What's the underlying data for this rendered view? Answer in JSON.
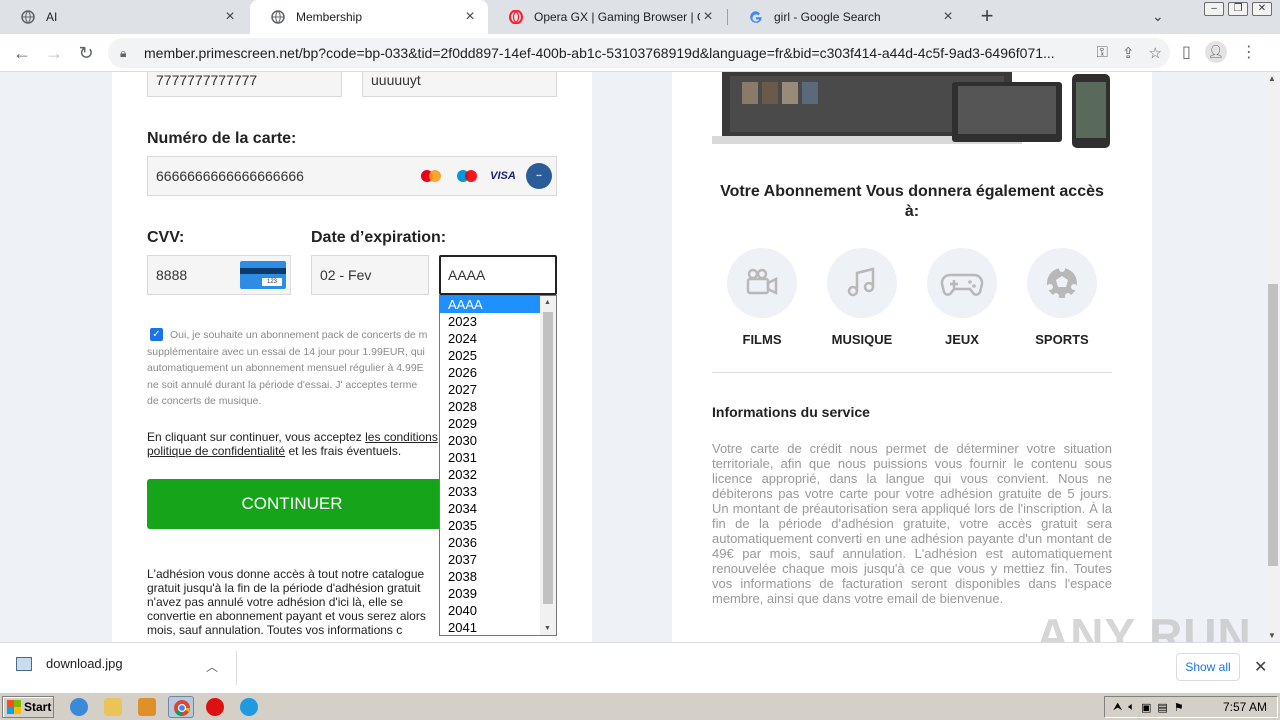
{
  "browser": {
    "tabs": [
      {
        "label": "AI",
        "active": false
      },
      {
        "label": "Membership",
        "active": true
      },
      {
        "label": "Opera GX | Gaming Browser | Opera",
        "active": false
      },
      {
        "label": "girl - Google Search",
        "active": false
      }
    ],
    "new_tab": "+",
    "url": "member.primescreen.net/bp?code=bp-033&tid=2f0dd897-14ef-400b-ab1c-53103768919d&language=fr&bid=c303f414-a44d-4c5f-9ad3-6496f071..."
  },
  "form": {
    "top_field_1": "7777777777777",
    "top_field_2": "uuuuuyt",
    "card_number_label": "Numéro de la carte:",
    "card_number_value": "6666666666666666666",
    "cvv_label": "CVV:",
    "cvv_value": "8888",
    "cvv_card_number": "123",
    "expiry_label": "Date d’expiration:",
    "expiry_month": "02 - Fev",
    "expiry_year": "AAAA",
    "checkbox_checked": true,
    "consent_line_1": "Oui, je souhaite un abonnement pack de concerts de m",
    "consent_line_2": "supplémentaire avec un essai de 14 jour pour 1.99EUR, qui",
    "consent_line_3": "automatiquement un abonnement mensuel régulier à 4.99E",
    "consent_line_4": "ne soit annulé durant la période d'essai. J' acceptes terme",
    "consent_line_5": "de concerts de musique.",
    "terms_prefix": "En cliquant sur continuer, vous acceptez ",
    "terms_link": "les conditions",
    "privacy_link": "politique de confidentialité",
    "terms_suffix": " et les frais éventuels.",
    "continue_label": "CONTINUER",
    "adhesion_line_1": "L'adhésion vous donne accès à tout notre catalogue",
    "adhesion_line_2": "gratuit jusqu'à la fin de la période d'adhésion gratuit",
    "adhesion_line_3": "n'avez pas annulé votre adhésion d'ici là, elle se",
    "adhesion_line_4": "convertie en abonnement payant et vous serez alors",
    "adhesion_line_5": "mois, sauf annulation. Toutes vos informations c"
  },
  "year_dropdown": {
    "selected": "AAAA",
    "options": [
      "AAAA",
      "2023",
      "2024",
      "2025",
      "2026",
      "2027",
      "2028",
      "2029",
      "2030",
      "2031",
      "2032",
      "2033",
      "2034",
      "2035",
      "2036",
      "2037",
      "2038",
      "2039",
      "2040",
      "2041"
    ]
  },
  "info": {
    "subscription_title": "Votre Abonnement Vous donnera également accès à:",
    "features": [
      {
        "label": "FILMS",
        "icon": "video-camera-icon"
      },
      {
        "label": "MUSIQUE",
        "icon": "music-note-icon"
      },
      {
        "label": "JEUX",
        "icon": "gamepad-icon"
      },
      {
        "label": "SPORTS",
        "icon": "soccer-ball-icon"
      }
    ],
    "service_title": "Informations du service",
    "service_text": "Votre carte de crédit nous permet de déterminer votre situation territoriale, afin que nous puissions vous fournir le contenu sous licence approprié, dans la langue qui vous convient. Nous ne débiterons pas votre carte pour votre adhésion gratuite de 5 jours. Un montant de préautorisation sera appliqué lors de l'inscription. À la fin de la période d'adhésion gratuite, votre accès gratuit sera automatiquement converti en une adhésion payante d'un montant de 49€ par mois, sauf annulation. L'adhésion est automatiquement renouvelée chaque mois jusqu'à ce que vous y mettiez fin. Toutes vos informations de facturation seront disponibles dans l'espace membre, ainsi que dans votre email de bienvenue."
  },
  "downloads": {
    "file": "download.jpg",
    "show_all": "Show all"
  },
  "watermark": "ANY RUN",
  "taskbar": {
    "start": "Start",
    "clock": "7:57 AM"
  },
  "colors": {
    "continue_green": "#16a51a",
    "dropdown_selected": "#1e90ff",
    "page_bg": "#eef1f6"
  }
}
